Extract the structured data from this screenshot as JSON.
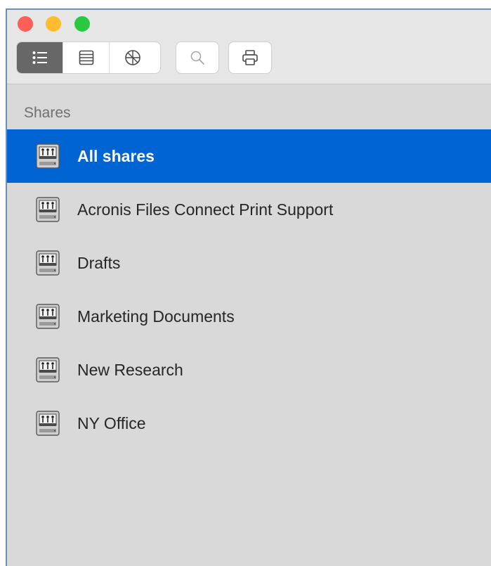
{
  "window": {
    "traffic_lights": [
      "close",
      "minimize",
      "zoom"
    ]
  },
  "toolbar": {
    "view_modes": [
      {
        "icon": "list-view-icon",
        "active": true
      },
      {
        "icon": "columns-view-icon",
        "active": false
      },
      {
        "icon": "network-view-icon",
        "active": false
      }
    ],
    "search_icon": "search-icon",
    "print_icon": "printer-icon"
  },
  "sidebar": {
    "section_title": "Shares",
    "items": [
      {
        "label": "All shares",
        "selected": true,
        "icon": "shared-drive-icon"
      },
      {
        "label": "Acronis Files Connect Print Support",
        "selected": false,
        "icon": "shared-drive-icon"
      },
      {
        "label": "Drafts",
        "selected": false,
        "icon": "shared-drive-icon"
      },
      {
        "label": "Marketing Documents",
        "selected": false,
        "icon": "shared-drive-icon"
      },
      {
        "label": "New Research",
        "selected": false,
        "icon": "shared-drive-icon"
      },
      {
        "label": "NY Office",
        "selected": false,
        "icon": "shared-drive-icon"
      }
    ]
  },
  "colors": {
    "selection": "#0064d2",
    "sidebar_bg": "#d9d9d9",
    "close": "#fe5f57",
    "minimize": "#febc2e",
    "zoom": "#28c840"
  }
}
